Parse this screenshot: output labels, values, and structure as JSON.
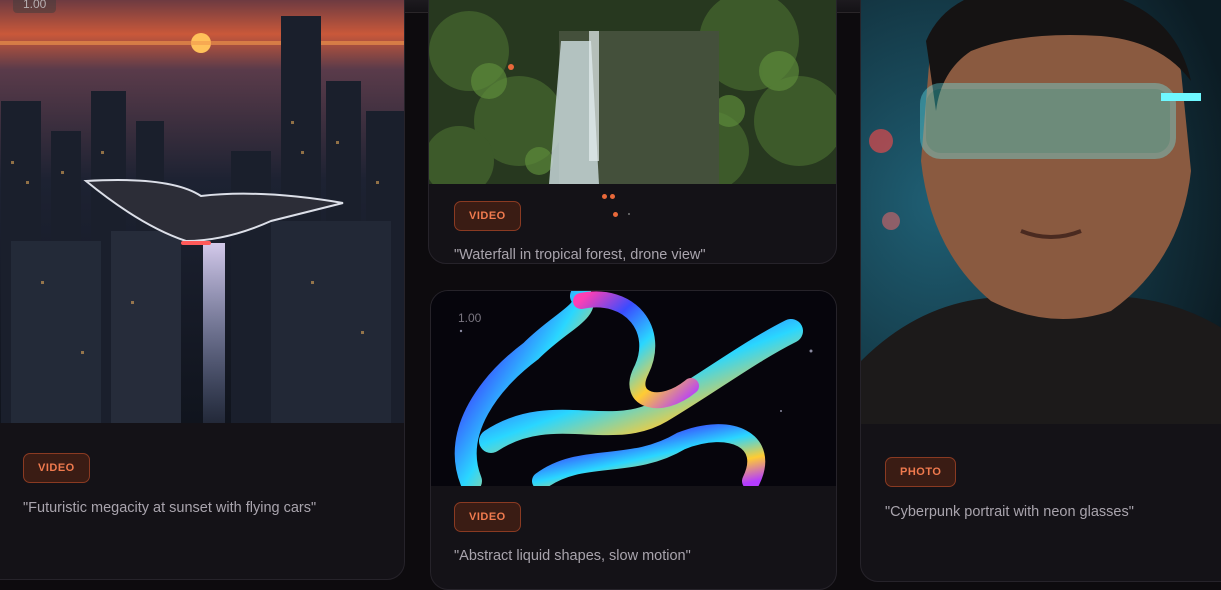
{
  "cards": [
    {
      "tag": "VIDEO",
      "caption": "\"Futuristic megacity at sunset with flying cars\"",
      "speed": "1.00",
      "image": "megacity-sunset-flying-car"
    },
    {
      "tag": "VIDEO",
      "caption": "\"Waterfall in tropical forest, drone view\"",
      "image": "tropical-waterfall"
    },
    {
      "tag": "VIDEO",
      "caption": "\"Abstract liquid shapes, slow motion\"",
      "speed": "1.00",
      "image": "iridescent-liquid-shapes"
    },
    {
      "tag": "PHOTO",
      "caption": "\"Cyberpunk portrait with neon glasses\"",
      "image": "man-with-neon-glasses"
    }
  ],
  "colors": {
    "accent": "#f07a4e",
    "badge_bg": "#3a1c14",
    "card_bg": "#141217"
  }
}
